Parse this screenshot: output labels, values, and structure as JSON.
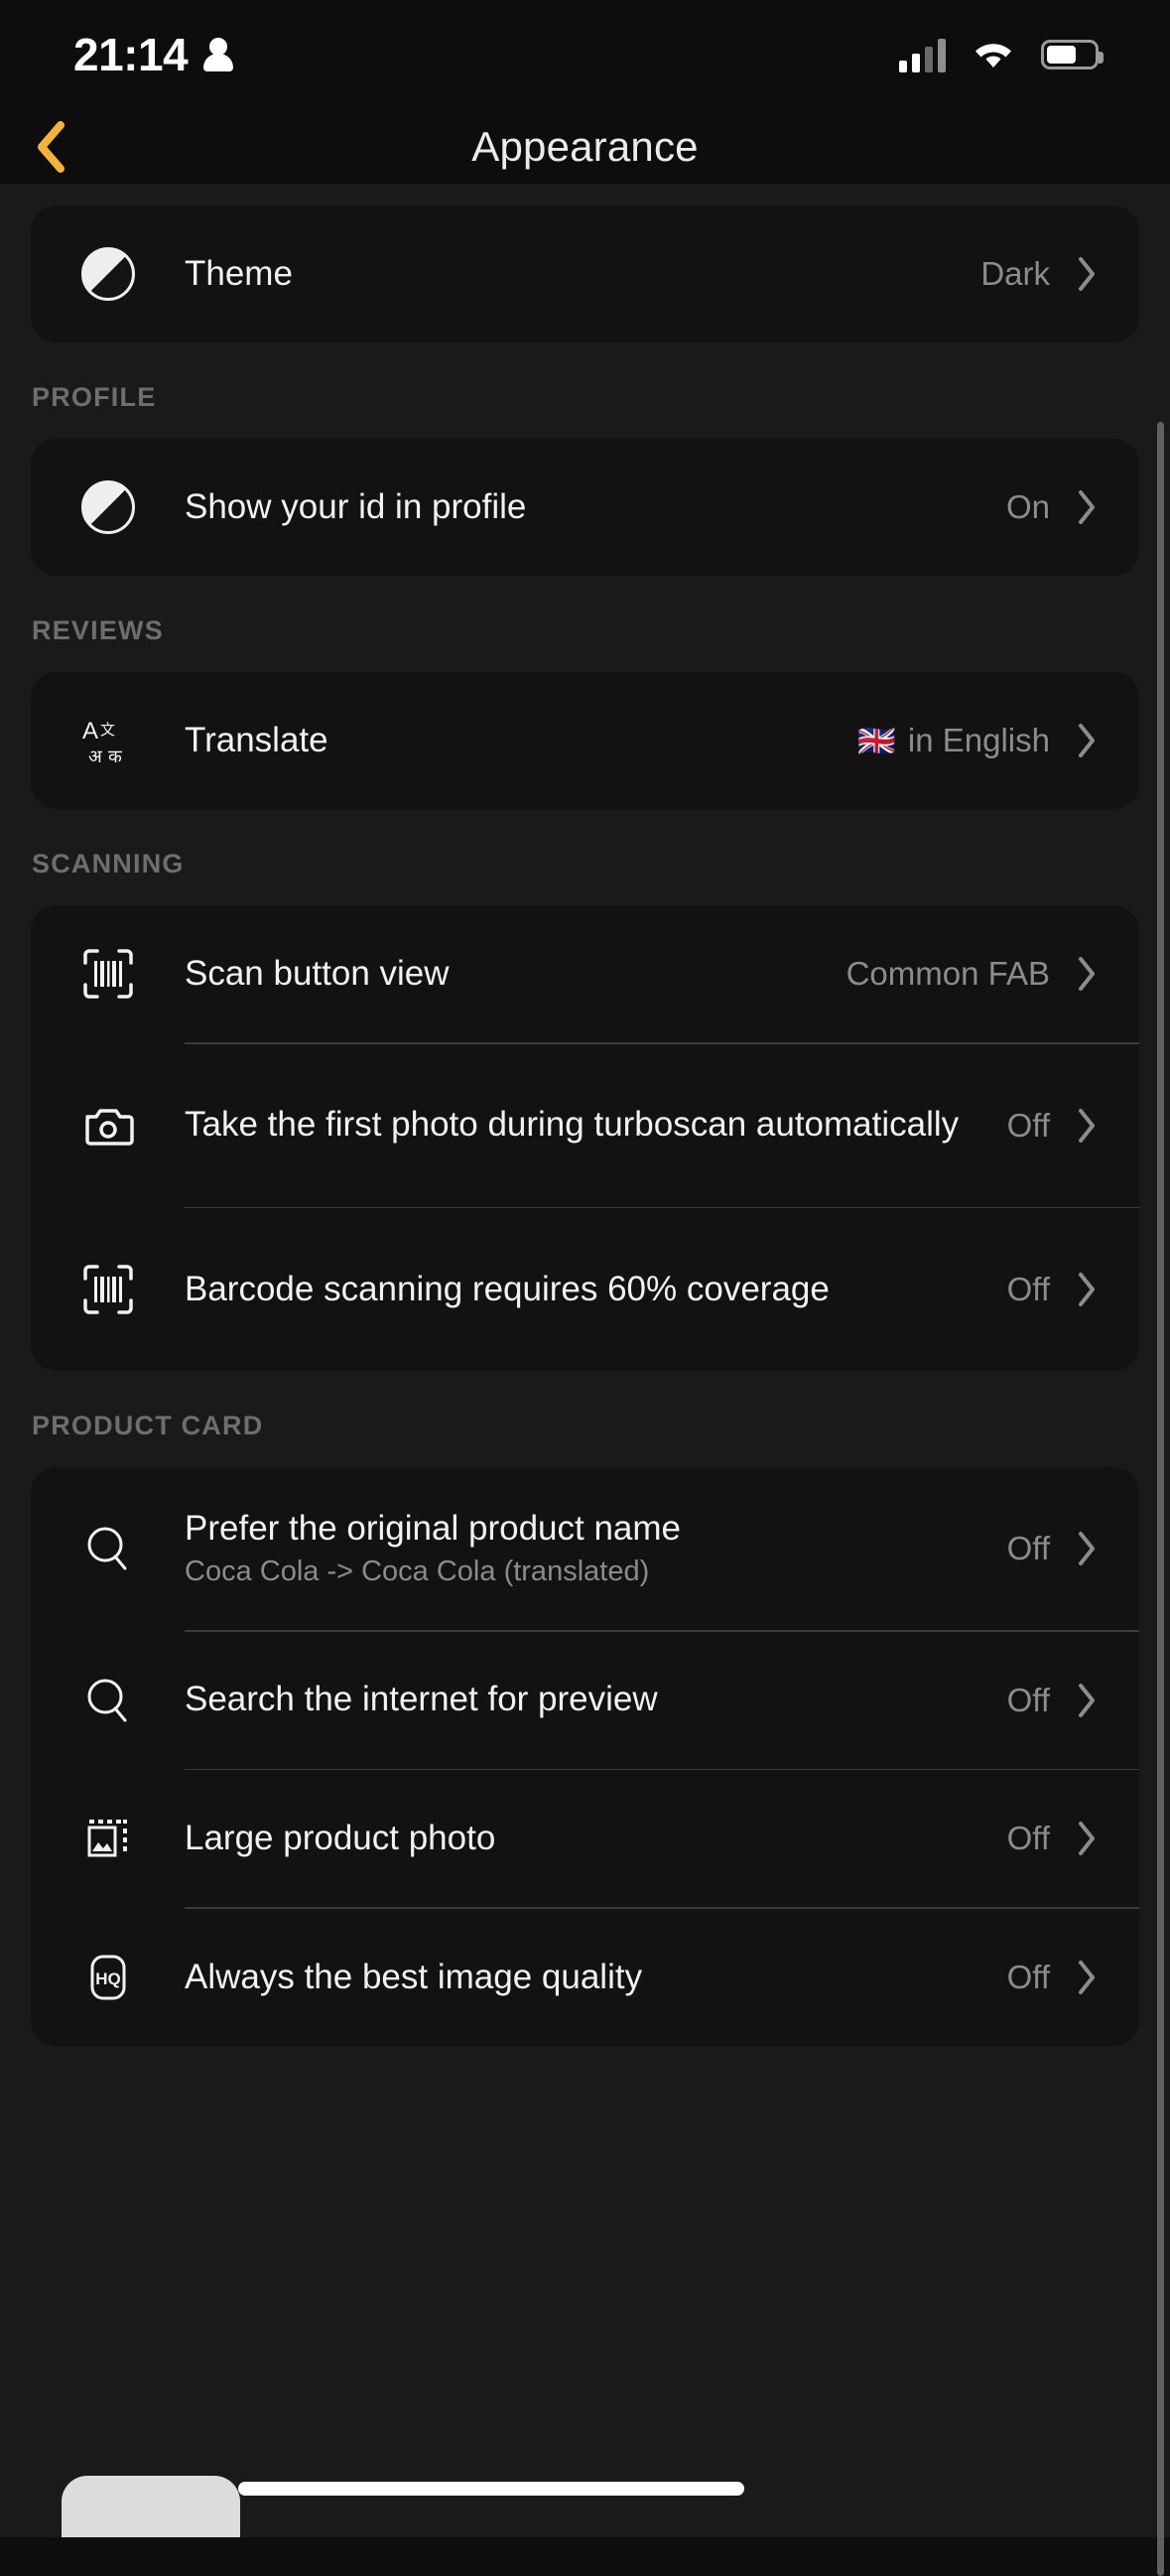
{
  "status_bar": {
    "time": "21:14",
    "person_icon": "person-icon",
    "signal_icon": "cellular-signal-icon",
    "wifi_icon": "wifi-icon",
    "battery_icon": "battery-icon"
  },
  "nav": {
    "back_icon": "chevron-left-icon",
    "back_color": "#F5B335",
    "title": "Appearance"
  },
  "colors": {
    "page_bg": "#1a1a1a",
    "header_bg": "#0d0d0d",
    "card_bg": "#121212",
    "accent": "#F5B335",
    "label": "#f2f2f2",
    "value": "#8c8c8c",
    "section": "#6e6e6e",
    "divider": "#3b3b3b"
  },
  "sections": [
    {
      "header": null,
      "rows": [
        {
          "icon": "contrast-circle-icon",
          "title": "Theme",
          "subtitle": null,
          "value": "Dark",
          "flag": null
        }
      ]
    },
    {
      "header": "PROFILE",
      "rows": [
        {
          "icon": "contrast-circle-icon",
          "title": "Show your id in profile",
          "subtitle": null,
          "value": "On",
          "flag": null
        }
      ]
    },
    {
      "header": "REVIEWS",
      "rows": [
        {
          "icon": "translate-icon",
          "title": "Translate",
          "subtitle": null,
          "value": "in English",
          "flag": "🇬🇧"
        }
      ]
    },
    {
      "header": "SCANNING",
      "rows": [
        {
          "icon": "barcode-scan-icon",
          "title": "Scan button view",
          "subtitle": null,
          "value": "Common FAB",
          "flag": null
        },
        {
          "icon": "camera-icon",
          "title": "Take the first photo during turboscan automatically",
          "subtitle": null,
          "value": "Off",
          "flag": null
        },
        {
          "icon": "barcode-scan-icon",
          "title": "Barcode scanning requires 60% coverage",
          "subtitle": null,
          "value": "Off",
          "flag": null
        }
      ]
    },
    {
      "header": "PRODUCT CARD",
      "rows": [
        {
          "icon": "search-icon",
          "title": "Prefer the original product name",
          "subtitle": "Coca Cola -> Coca Cola (translated)",
          "value": "Off",
          "flag": null
        },
        {
          "icon": "search-icon",
          "title": "Search the internet for preview",
          "subtitle": null,
          "value": "Off",
          "flag": null
        },
        {
          "icon": "image-frame-icon",
          "title": "Large product photo",
          "subtitle": null,
          "value": "Off",
          "flag": null
        },
        {
          "icon": "hq-badge-icon",
          "title": "Always the best image quality",
          "subtitle": null,
          "value": "Off",
          "flag": null
        }
      ]
    }
  ],
  "chevron_icon": "chevron-right-icon",
  "scrollbar": "vertical-scrollbar",
  "home_indicator": "home-indicator"
}
